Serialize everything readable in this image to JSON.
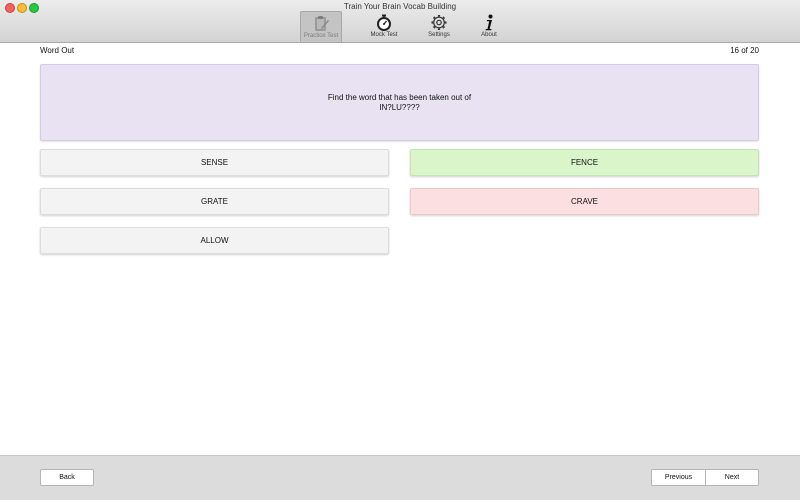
{
  "window": {
    "title": "Train Your Brain Vocab Building"
  },
  "toolbar": {
    "items": [
      {
        "label": "Practice Test",
        "icon": "clipboard-icon",
        "active": true
      },
      {
        "label": "Mock Test",
        "icon": "stopwatch-icon",
        "active": false
      },
      {
        "label": "Settings",
        "icon": "gear-icon",
        "active": false
      },
      {
        "label": "About",
        "icon": "info-icon",
        "active": false
      }
    ]
  },
  "header": {
    "section": "Word Out",
    "progress": "16 of 20"
  },
  "question": {
    "line1": "Find the word that has been taken out of",
    "line2": "IN?LU????"
  },
  "answers": [
    {
      "label": "SENSE",
      "state": "neutral"
    },
    {
      "label": "FENCE",
      "state": "correct"
    },
    {
      "label": "GRATE",
      "state": "neutral"
    },
    {
      "label": "CRAVE",
      "state": "wrong"
    },
    {
      "label": "ALLOW",
      "state": "neutral"
    }
  ],
  "footer": {
    "back_label": "Back",
    "previous_label": "Previous",
    "next_label": "Next"
  },
  "colors": {
    "question_bg": "#e8e2f2",
    "correct_bg": "#d9f5c9",
    "wrong_bg": "#fbdfe1",
    "neutral_bg": "#f3f3f3"
  }
}
